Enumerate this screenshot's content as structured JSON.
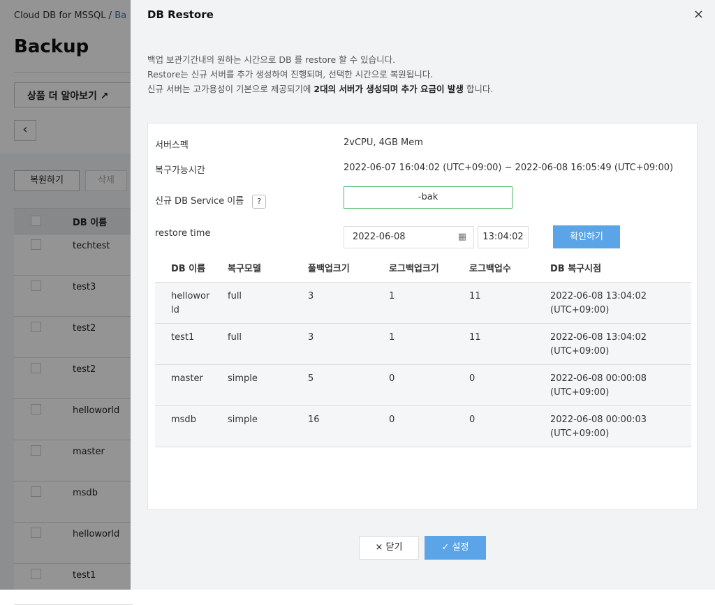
{
  "background": {
    "breadcrumb": {
      "root": "Cloud DB for MSSQL",
      "sep": "/",
      "current": "Ba"
    },
    "title": "Backup",
    "learn_more": "상품 더 알아보기 ↗",
    "back_icon": "chevron-left-icon",
    "restore_button": "복원하기",
    "delete_button": "삭제",
    "table_header": "DB 이름",
    "rows": [
      "techtest",
      "test3",
      "test2",
      "test2",
      "helloworld",
      "master",
      "msdb",
      "helloworld",
      "test1"
    ]
  },
  "modal": {
    "title": "DB Restore",
    "close_icon": "×",
    "desc_line1": "백업 보관기간내의 원하는 시간으로 DB 를 restore 할 수 있습니다.",
    "desc_line2": "Restore는 신규 서버를 추가 생성하여 진행되며, 선택한 시간으로 복원됩니다.",
    "desc_line3_prefix": "신규 서버는 고가용성이 기본으로 제공되기에 ",
    "desc_line3_bold": "2대의 서버가 생성되며 추가 요금이 발생",
    "desc_line3_suffix": " 합니다.",
    "spec_label": "서버스펙",
    "spec_value": "2vCPU, 4GB Mem",
    "range_label": "복구가능시간",
    "range_value": "2022-06-07 16:04:02 (UTC+09:00) ~ 2022-06-08 16:05:49 (UTC+09:00)",
    "service_label": "신규 DB Service 이름",
    "help_icon": "?",
    "service_value": "-bak",
    "restore_time_label": "restore time",
    "date_value": "2022-06-08",
    "calendar_icon": "▦",
    "time_value": "13:04:02",
    "confirm_button": "확인하기",
    "table": {
      "headers": [
        "DB 이름",
        "복구모델",
        "풀백업크기",
        "로그백업크기",
        "로그백업수",
        "DB 복구시점"
      ],
      "rows": [
        [
          "hellowor ld",
          "full",
          "3",
          "1",
          "11",
          "2022-06-08 13:04:02 (UTC+09:00)"
        ],
        [
          "test1",
          "full",
          "3",
          "1",
          "11",
          "2022-06-08 13:04:02 (UTC+09:00)"
        ],
        [
          "master",
          "simple",
          "5",
          "0",
          "0",
          "2022-06-08 00:00:08 (UTC+09:00)"
        ],
        [
          "msdb",
          "simple",
          "16",
          "0",
          "0",
          "2022-06-08 00:00:03 (UTC+09:00)"
        ]
      ]
    },
    "close_button": "× 닫기",
    "set_button": "✓ 설정"
  }
}
